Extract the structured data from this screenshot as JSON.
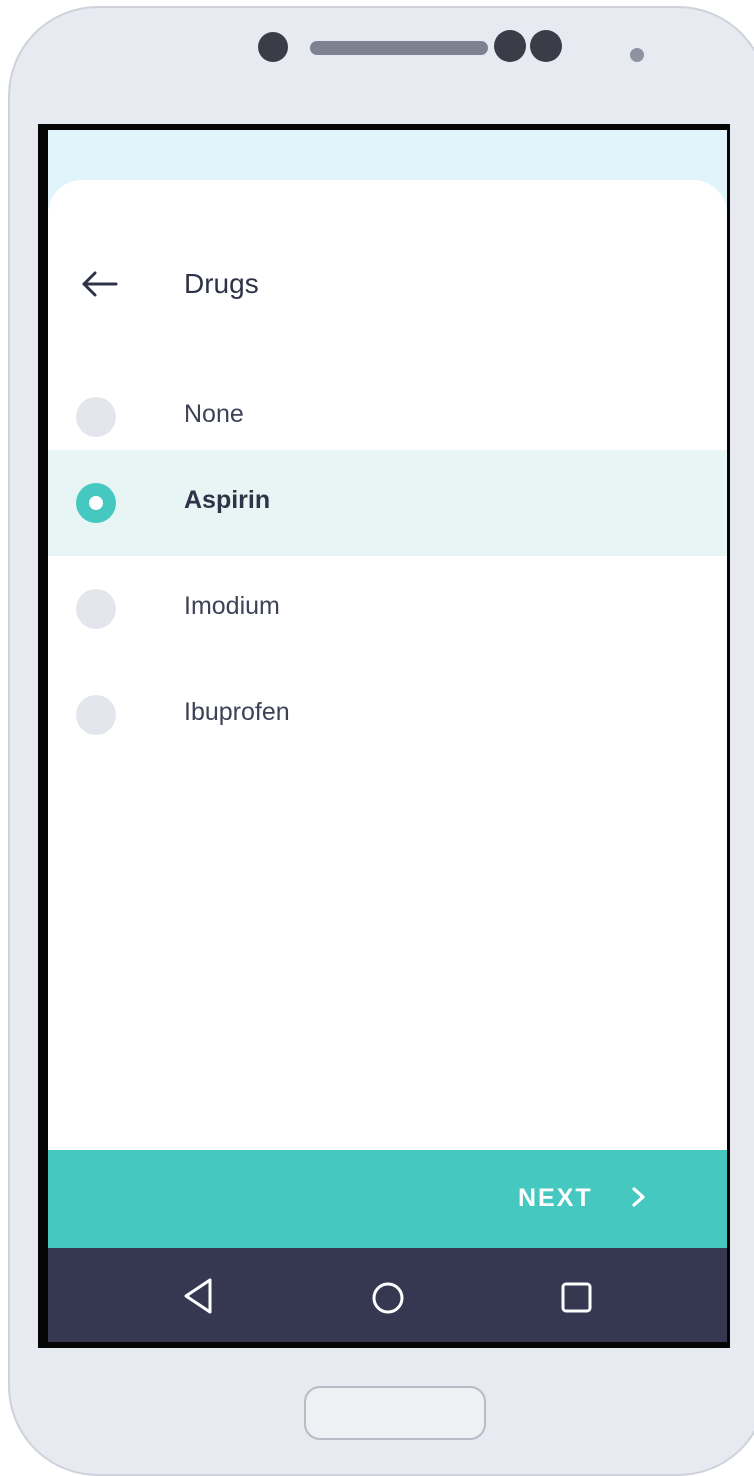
{
  "header": {
    "title": "Drugs"
  },
  "options": [
    {
      "label": "None",
      "selected": false
    },
    {
      "label": "Aspirin",
      "selected": true
    },
    {
      "label": "Imodium",
      "selected": false
    },
    {
      "label": "Ibuprofen",
      "selected": false
    }
  ],
  "footer": {
    "next_label": "NEXT"
  },
  "icons": {
    "back": "arrow-left-icon",
    "next": "chevron-right-icon",
    "nav_back": "triangle-back-icon",
    "nav_home": "circle-home-icon",
    "nav_recents": "square-recents-icon"
  },
  "colors": {
    "accent": "#45c8c0",
    "selected_row": "#e7f6f4",
    "nav_bar": "#363852",
    "header_bg": "#e2f4fb"
  }
}
